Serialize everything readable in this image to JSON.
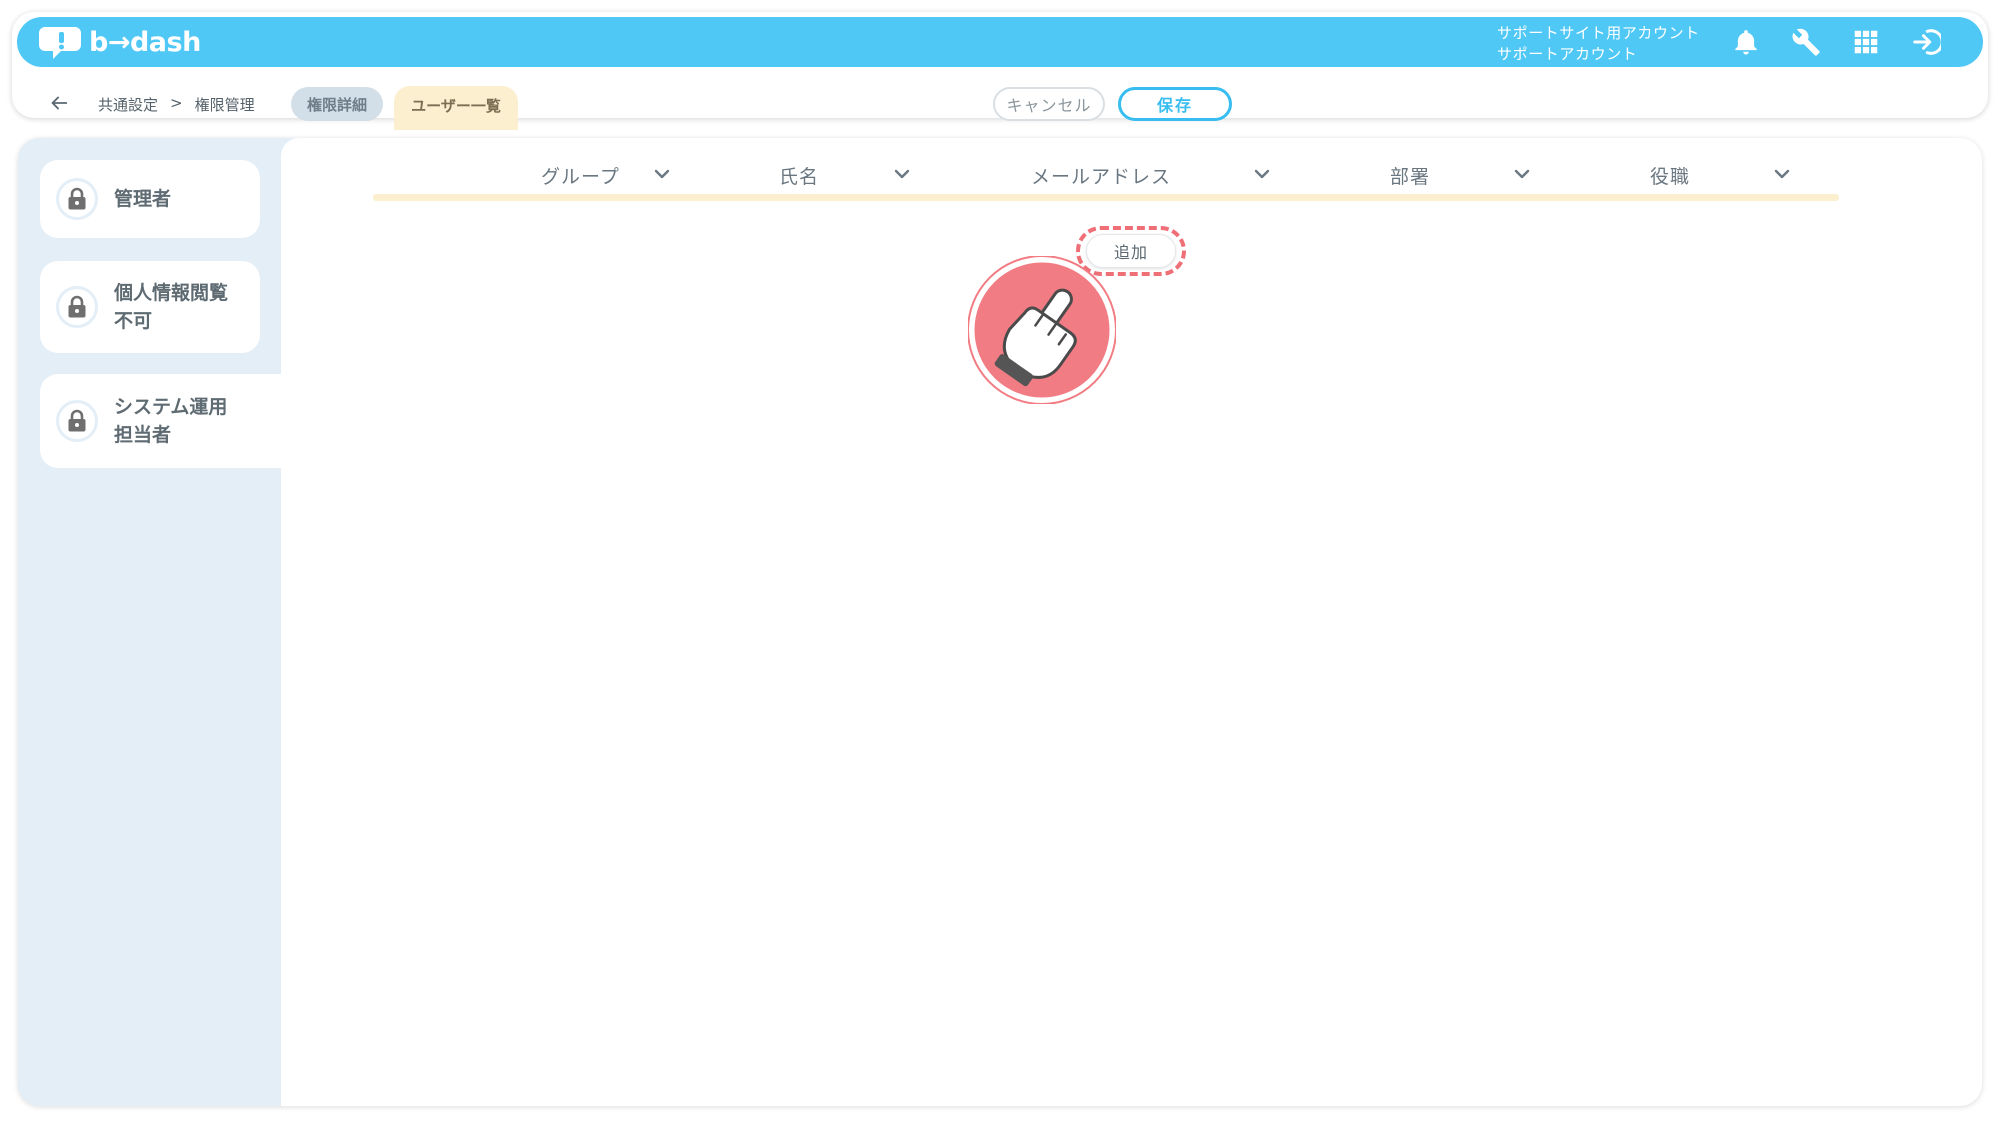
{
  "app": {
    "logo_text": "b→dash"
  },
  "account": {
    "line1": "サポートサイト用アカウント",
    "line2": "サポートアカウント"
  },
  "header_icons": [
    "bell-icon",
    "wrench-icon",
    "grid-icon",
    "logout-icon"
  ],
  "breadcrumb": {
    "parent": "共通設定",
    "separator": ">",
    "current": "権限管理"
  },
  "tabs": {
    "detail": "権限詳細",
    "users": "ユーザー一覧"
  },
  "actions": {
    "cancel": "キャンセル",
    "save": "保存"
  },
  "roles": [
    {
      "label": "管理者"
    },
    {
      "label": "個人情報閲覧\n不可"
    },
    {
      "label": "システム運用\n担当者"
    }
  ],
  "table": {
    "columns": [
      "グループ",
      "氏名",
      "メールアドレス",
      "部署",
      "役職"
    ]
  },
  "add_button": "追加",
  "colors": {
    "topbar": "#4fc8f6",
    "accent": "#38bdf0",
    "highlight": "#ef6f77",
    "tab_active": "#fcefcf",
    "sidebar": "#e3eef7"
  }
}
